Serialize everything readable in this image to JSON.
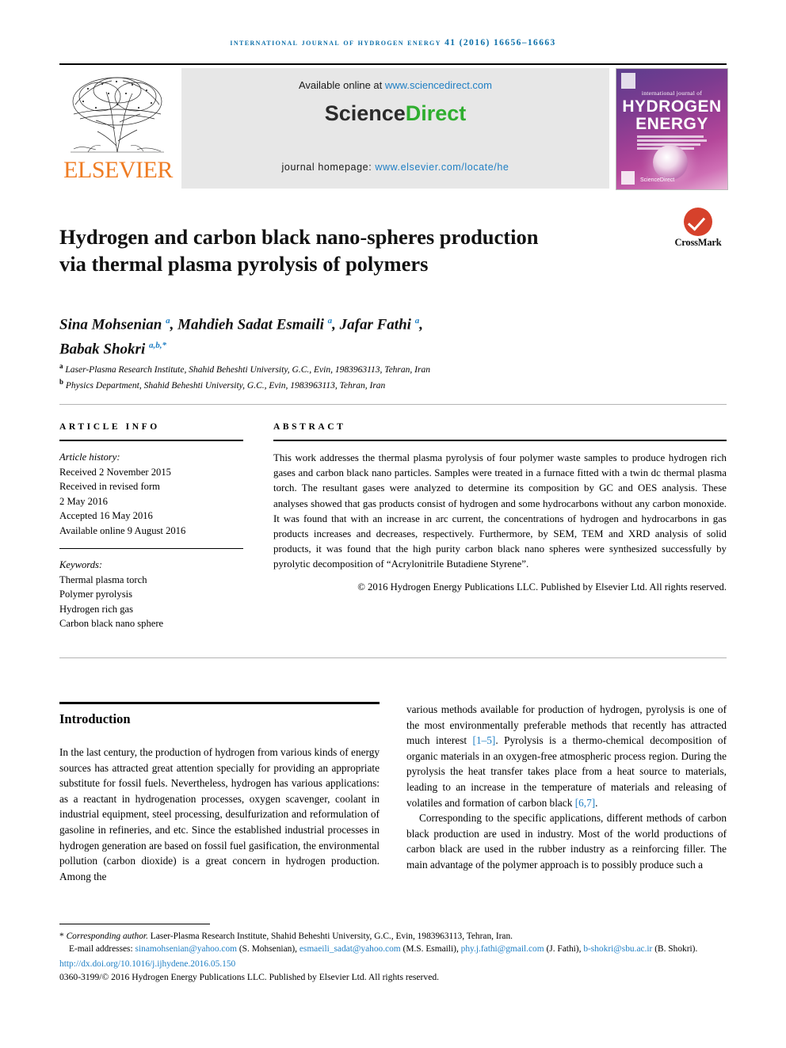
{
  "running_head": "INTERNATIONAL JOURNAL OF HYDROGEN ENERGY 41 (2016) 16656–16663",
  "banner": {
    "publisher_name": "ELSEVIER",
    "available_prefix": "Available online at ",
    "available_url": "www.sciencedirect.com",
    "sciencedirect_part1": "Science",
    "sciencedirect_part2": "Direct",
    "homepage_prefix": "journal homepage: ",
    "homepage_url": "www.elsevier.com/locate/he",
    "cover": {
      "superline": "international journal of",
      "line1": "HYDROGEN",
      "line2": "ENERGY",
      "footer_text": "ScienceDirect"
    }
  },
  "crossmark": {
    "label": "CrossMark",
    "icon": "crossmark-check-icon",
    "color": "#d6412b"
  },
  "article": {
    "title": "Hydrogen and carbon black nano-spheres production via thermal plasma pyrolysis of polymers",
    "authors_line1_a": "Sina Mohsenian ",
    "authors_sup_a1": "a",
    "authors_line1_b": ", Mahdieh Sadat Esmaili ",
    "authors_sup_a2": "a",
    "authors_line1_c": ", Jafar Fathi ",
    "authors_sup_a3": "a",
    "authors_line1_d": ",",
    "authors_line2": "Babak Shokri ",
    "authors_sup_b": "a,b,*",
    "affiliation_a_marker": "a",
    "affiliation_a": " Laser-Plasma Research Institute, Shahid Beheshti University, G.C., Evin, 1983963113, Tehran, Iran",
    "affiliation_b_marker": "b",
    "affiliation_b": " Physics Department, Shahid Beheshti University, G.C., Evin, 1983963113, Tehran, Iran"
  },
  "article_info": {
    "heading": "ARTICLE INFO",
    "history_label": "Article history:",
    "history": [
      "Received 2 November 2015",
      "Received in revised form",
      "2 May 2016",
      "Accepted 16 May 2016",
      "Available online 9 August 2016"
    ],
    "keywords_label": "Keywords:",
    "keywords": [
      "Thermal plasma torch",
      "Polymer pyrolysis",
      "Hydrogen rich gas",
      "Carbon black nano sphere"
    ]
  },
  "abstract": {
    "heading": "ABSTRACT",
    "body": "This work addresses the thermal plasma pyrolysis of four polymer waste samples to produce hydrogen rich gases and carbon black nano particles. Samples were treated in a furnace fitted with a twin dc thermal plasma torch. The resultant gases were analyzed to determine its composition by GC and OES analysis. These analyses showed that gas products consist of hydrogen and some hydrocarbons without any carbon monoxide. It was found that with an increase in arc current, the concentrations of hydrogen and hydrocarbons in gas products increases and decreases, respectively. Furthermore, by SEM, TEM and XRD analysis of solid products, it was found that the high purity carbon black nano spheres were synthesized successfully by pyrolytic decomposition of “Acrylonitrile Butadiene Styrene”.",
    "copyright": "© 2016 Hydrogen Energy Publications LLC. Published by Elsevier Ltd. All rights reserved."
  },
  "introduction": {
    "heading": "Introduction",
    "left_paragraph": "In the last century, the production of hydrogen from various kinds of energy sources has attracted great attention specially for providing an appropriate substitute for fossil fuels. Nevertheless, hydrogen has various applications: as a reactant in hydrogenation processes, oxygen scavenger, coolant in industrial equipment, steel processing, desulfurization and reformulation of gasoline in refineries, and etc. Since the established industrial processes in hydrogen generation are based on fossil fuel gasification, the environmental pollution (carbon dioxide) is a great concern in hydrogen production. Among the",
    "right_p1_before": "various methods available for production of hydrogen, pyrolysis is one of the most environmentally preferable methods that recently has attracted much interest ",
    "right_p1_cite1": "[1–5]",
    "right_p1_mid": ". Pyrolysis is a thermo-chemical decomposition of organic materials in an oxygen-free atmospheric process region. During the pyrolysis the heat transfer takes place from a heat source to materials, leading to an increase in the temperature of materials and releasing of volatiles and formation of carbon black ",
    "right_p1_cite2": "[6,7]",
    "right_p1_after": ".",
    "right_p2": "Corresponding to the specific applications, different methods of carbon black production are used in industry. Most of the world productions of carbon black are used in the rubber industry as a reinforcing filler. The main advantage of the polymer approach is to possibly produce such a"
  },
  "footer": {
    "corresponding_marker": "*",
    "corresponding_label": "Corresponding author.",
    "corresponding_address": " Laser-Plasma Research Institute, Shahid Beheshti University, G.C., Evin, 1983963113, Tehran, Iran.",
    "email_label": "E-mail addresses:",
    "emails": [
      {
        "address": "sinamohsenian@yahoo.com",
        "person": "(S. Mohsenian)"
      },
      {
        "address": "esmaeili_sadat@yahoo.com",
        "person": "(M.S. Esmaili)"
      },
      {
        "address": "phy.j.fathi@gmail.com",
        "person": "(J. Fathi)"
      },
      {
        "address": "b-shokri@sbu.ac.ir",
        "person": "(B. Shokri)"
      }
    ],
    "doi": "http://dx.doi.org/10.1016/j.ijhydene.2016.05.150",
    "issn_line": "0360-3199/© 2016 Hydrogen Energy Publications LLC. Published by Elsevier Ltd. All rights reserved."
  }
}
